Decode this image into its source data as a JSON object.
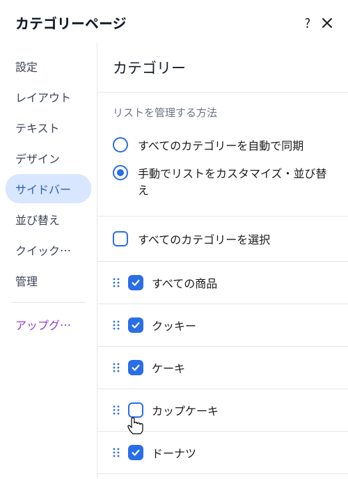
{
  "header": {
    "title": "カテゴリーページ"
  },
  "sidebar": {
    "items": [
      {
        "label": "設定",
        "active": false
      },
      {
        "label": "レイアウト",
        "active": false
      },
      {
        "label": "テキスト",
        "active": false
      },
      {
        "label": "デザイン",
        "active": false
      },
      {
        "label": "サイドバー",
        "active": true
      },
      {
        "label": "並び替え",
        "active": false
      },
      {
        "label": "クイック…",
        "active": false
      },
      {
        "label": "管理",
        "active": false
      }
    ],
    "upgrade_label": "アップグ…"
  },
  "main": {
    "title": "カテゴリー",
    "radio": {
      "heading": "リストを管理する方法",
      "options": [
        {
          "label": "すべてのカテゴリーを自動で同期",
          "selected": false
        },
        {
          "label": "手動でリストをカスタマイズ・並び替え",
          "selected": true
        }
      ]
    },
    "select_all": {
      "label": "すべてのカテゴリーを選択",
      "checked": false
    },
    "categories": [
      {
        "label": "すべての商品",
        "checked": true
      },
      {
        "label": "クッキー",
        "checked": true
      },
      {
        "label": "ケーキ",
        "checked": true
      },
      {
        "label": "カップケーキ",
        "checked": false,
        "cursor": true
      },
      {
        "label": "ドーナツ",
        "checked": true
      }
    ]
  }
}
